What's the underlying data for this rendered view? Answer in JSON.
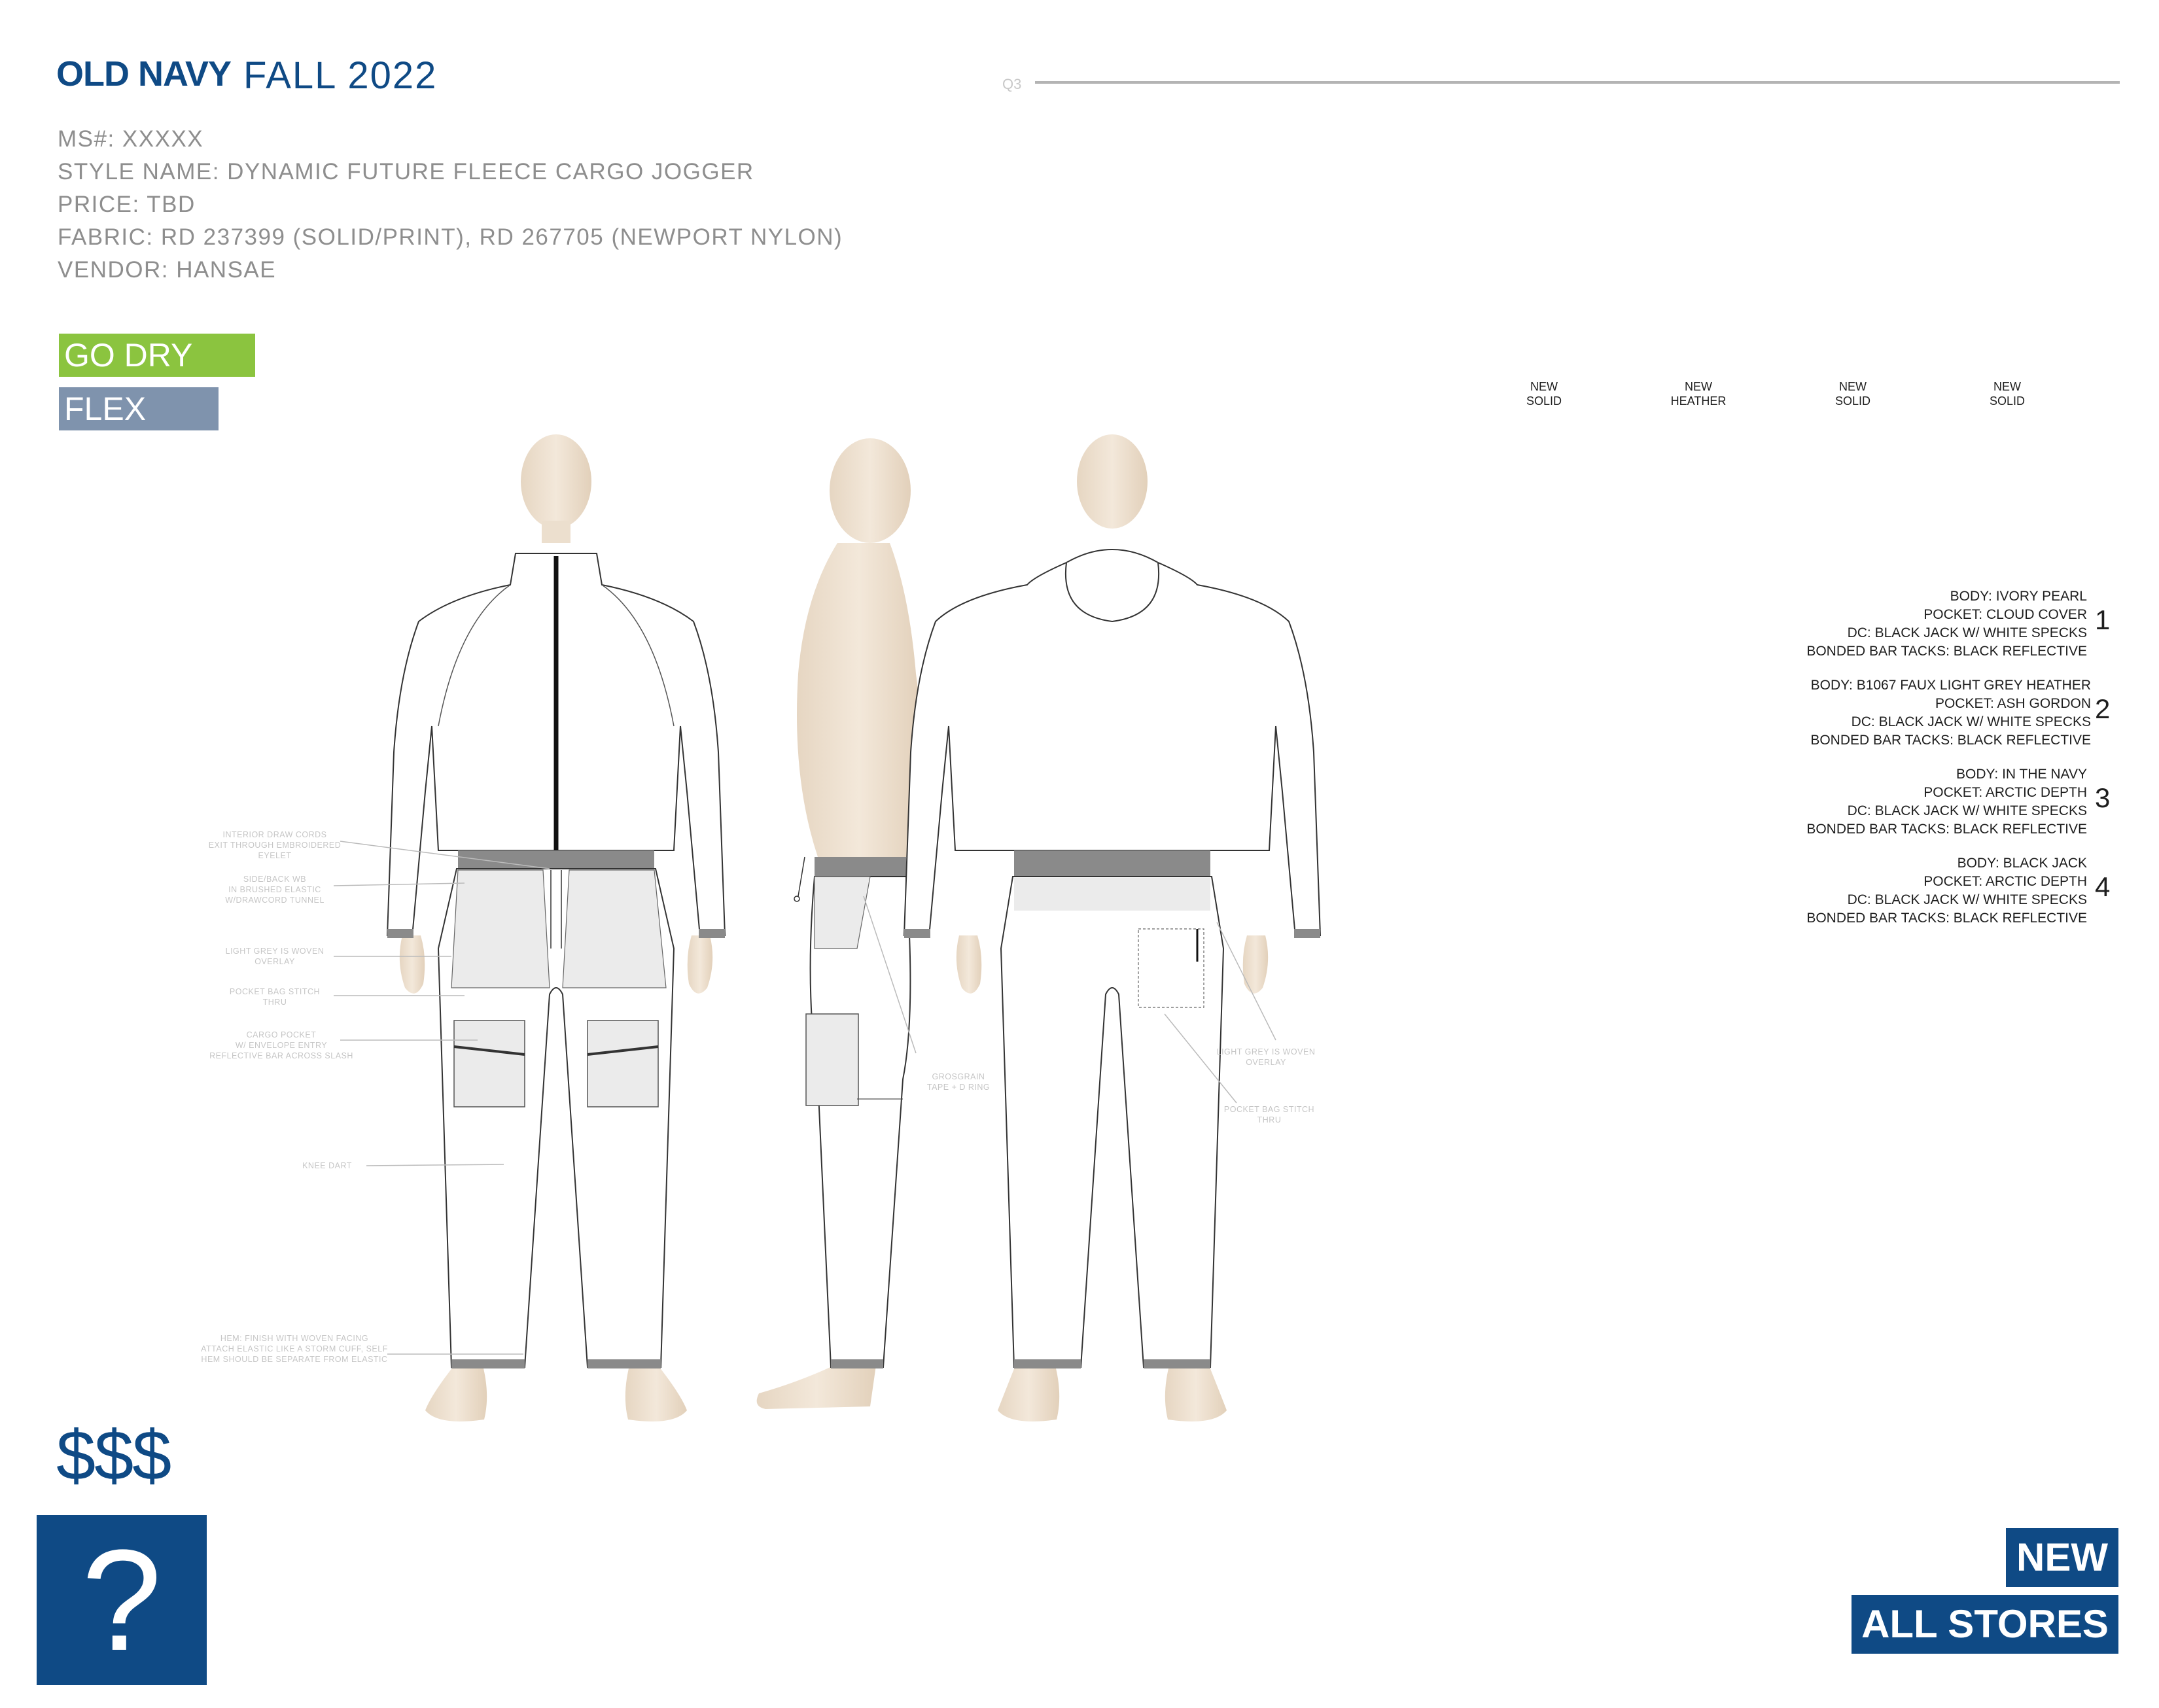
{
  "header": {
    "brand": "OLD NAVY",
    "season": "FALL 2022",
    "quarter": "Q3"
  },
  "details": {
    "ms": "MS#: XXXXX",
    "style_name": "STYLE NAME: DYNAMIC FUTURE FLEECE CARGO JOGGER",
    "price": "PRICE: TBD",
    "fabric": "FABRIC: RD 237399 (SOLID/PRINT), RD 267705 (NEWPORT NYLON)",
    "vendor": "VENDOR: HANSAE"
  },
  "tags": {
    "go_dry": "GO DRY",
    "flex": "FLEX"
  },
  "colorway_headers": [
    {
      "line1": "NEW",
      "line2": "SOLID"
    },
    {
      "line1": "NEW",
      "line2": "HEATHER"
    },
    {
      "line1": "NEW",
      "line2": "SOLID"
    },
    {
      "line1": "NEW",
      "line2": "SOLID"
    }
  ],
  "colorways": [
    {
      "number": "1",
      "lines": [
        "BODY: IVORY PEARL",
        "POCKET: CLOUD COVER",
        "DC: BLACK JACK W/ WHITE SPECKS",
        "BONDED BAR TACKS: BLACK REFLECTIVE"
      ]
    },
    {
      "number": "2",
      "lines": [
        "BODY: B1067 FAUX LIGHT GREY HEATHER",
        "POCKET: ASH GORDON",
        "DC: BLACK JACK W/ WHITE SPECKS",
        "BONDED BAR TACKS: BLACK REFLECTIVE"
      ]
    },
    {
      "number": "3",
      "lines": [
        "BODY: IN THE NAVY",
        "POCKET: ARCTIC DEPTH",
        "DC: BLACK JACK W/ WHITE SPECKS",
        "BONDED BAR TACKS: BLACK REFLECTIVE"
      ]
    },
    {
      "number": "4",
      "lines": [
        "BODY: BLACK JACK",
        "POCKET: ARCTIC DEPTH",
        "DC: BLACK JACK W/ WHITE SPECKS",
        "BONDED BAR TACKS: BLACK REFLECTIVE"
      ]
    }
  ],
  "callouts": {
    "draw_cords": [
      "INTERIOR DRAW CORDS",
      "EXIT THROUGH EMBROIDERED",
      "EYELET"
    ],
    "waistband": [
      "SIDE/BACK WB",
      "IN BRUSHED ELASTIC",
      "W/DRAWCORD TUNNEL"
    ],
    "overlay_front": [
      "LIGHT GREY IS WOVEN",
      "OVERLAY"
    ],
    "pocket_bag_front": [
      "POCKET BAG STITCH",
      "THRU"
    ],
    "cargo_pocket": [
      "CARGO POCKET",
      "W/ ENVELOPE ENTRY",
      "REFLECTIVE BAR ACROSS SLASH"
    ],
    "knee_dart": [
      "KNEE DART"
    ],
    "hem": [
      "HEM: FINISH WITH WOVEN FACING",
      "ATTACH ELASTIC LIKE A STORM CUFF, SELF",
      "HEM SHOULD BE SEPARATE FROM ELASTIC"
    ],
    "grosgrain": [
      "GROSGRAIN",
      "TAPE + D RING"
    ],
    "overlay_back": [
      "LIGHT GREY IS WOVEN",
      "OVERLAY"
    ],
    "pocket_bag_back": [
      "POCKET BAG STITCH",
      "THRU"
    ]
  },
  "footer": {
    "price_tier": "$$$",
    "unknown": "?",
    "new_badge": "NEW",
    "stores_badge": "ALL STORES"
  },
  "colors": {
    "brand_blue": "#0f4a85",
    "go_dry_green": "#8bc43f",
    "flex_blue_grey": "#7f93ad",
    "mannequin": "#f0e4d4",
    "overlay_grey": "#ebebeb",
    "waistband_grey": "#8a8a8a"
  }
}
